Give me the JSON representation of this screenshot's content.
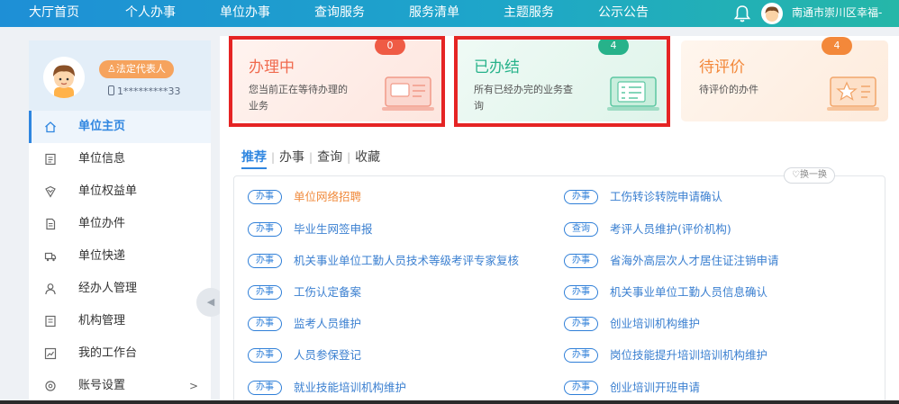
{
  "nav": {
    "items": [
      "大厅首页",
      "个人办事",
      "单位办事",
      "查询服务",
      "服务清单",
      "主题服务",
      "公示公告"
    ],
    "user": "南通市崇川区幸福-"
  },
  "profile": {
    "role": "法定代表人",
    "phone": "1*********33"
  },
  "sidebar": {
    "items": [
      {
        "label": "单位主页",
        "icon": "home-icon"
      },
      {
        "label": "单位信息",
        "icon": "document-icon"
      },
      {
        "label": "单位权益单",
        "icon": "shield-icon"
      },
      {
        "label": "单位办件",
        "icon": "file-icon"
      },
      {
        "label": "单位快递",
        "icon": "truck-icon"
      },
      {
        "label": "经办人管理",
        "icon": "person-icon"
      },
      {
        "label": "机构管理",
        "icon": "org-icon"
      },
      {
        "label": "我的工作台",
        "icon": "chart-icon"
      },
      {
        "label": "账号设置",
        "icon": "gear-icon"
      }
    ],
    "active_index": 0,
    "more_arrow": ">"
  },
  "cards": [
    {
      "title": "办理中",
      "desc": "您当前正在等待办理的业务",
      "count": "0",
      "color": "#f06a4e",
      "badge": "#ef5b45"
    },
    {
      "title": "已办结",
      "desc": "所有已经办完的业务查询",
      "count": "4",
      "color": "#27b28a",
      "badge": "#27b28a"
    },
    {
      "title": "待评价",
      "desc": "待评价的办件",
      "count": "4",
      "color": "#f3883a",
      "badge": "#f3883a"
    }
  ],
  "tabs": {
    "items": [
      "推荐",
      "办事",
      "查询",
      "收藏"
    ],
    "active_index": 0,
    "refresh": "换一换"
  },
  "services": [
    {
      "tag": "办事",
      "name": "单位网络招聘"
    },
    {
      "tag": "办事",
      "name": "工伤转诊转院申请确认"
    },
    {
      "tag": "办事",
      "name": "毕业生网签申报"
    },
    {
      "tag": "查询",
      "name": "考评人员维护(评价机构)"
    },
    {
      "tag": "办事",
      "name": "机关事业单位工勤人员技术等级考评专家复核"
    },
    {
      "tag": "办事",
      "name": "省海外高层次人才居住证注销申请"
    },
    {
      "tag": "办事",
      "name": "工伤认定备案"
    },
    {
      "tag": "办事",
      "name": "机关事业单位工勤人员信息确认"
    },
    {
      "tag": "办事",
      "name": "监考人员维护"
    },
    {
      "tag": "办事",
      "name": "创业培训机构维护"
    },
    {
      "tag": "办事",
      "name": "人员参保登记"
    },
    {
      "tag": "办事",
      "name": "岗位技能提升培训培训机构维护"
    },
    {
      "tag": "办事",
      "name": "就业技能培训机构维护"
    },
    {
      "tag": "办事",
      "name": "创业培训开班申请"
    }
  ]
}
